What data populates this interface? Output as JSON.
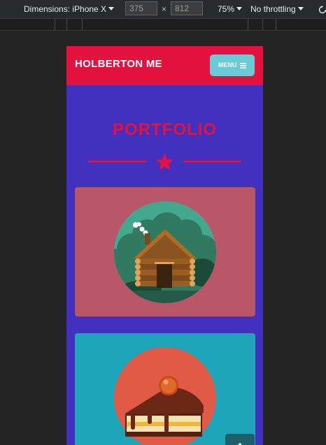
{
  "devtools": {
    "device_label": "Dimensions: iPhone X",
    "width_value": "375",
    "times": "×",
    "height_value": "812",
    "zoom": "75%",
    "throttling": "No throttling"
  },
  "site": {
    "brand": "HOLBERTON ME",
    "menu_label": "MENU",
    "menu_icon": "hamburger-icon",
    "page_title": "PORTFOLIO",
    "divider_icon": "star-icon",
    "accent_color": "#e3123e",
    "background_color": "#4131be",
    "menu_color": "#6ccad5"
  },
  "portfolio": {
    "items": [
      {
        "illustration": "log-cabin-icon",
        "card_color": "#b95768"
      },
      {
        "illustration": "cake-slice-icon",
        "card_color": "#1fa5b9"
      }
    ]
  },
  "controls": {
    "scroll_top_icon": "arrow-up-icon"
  }
}
